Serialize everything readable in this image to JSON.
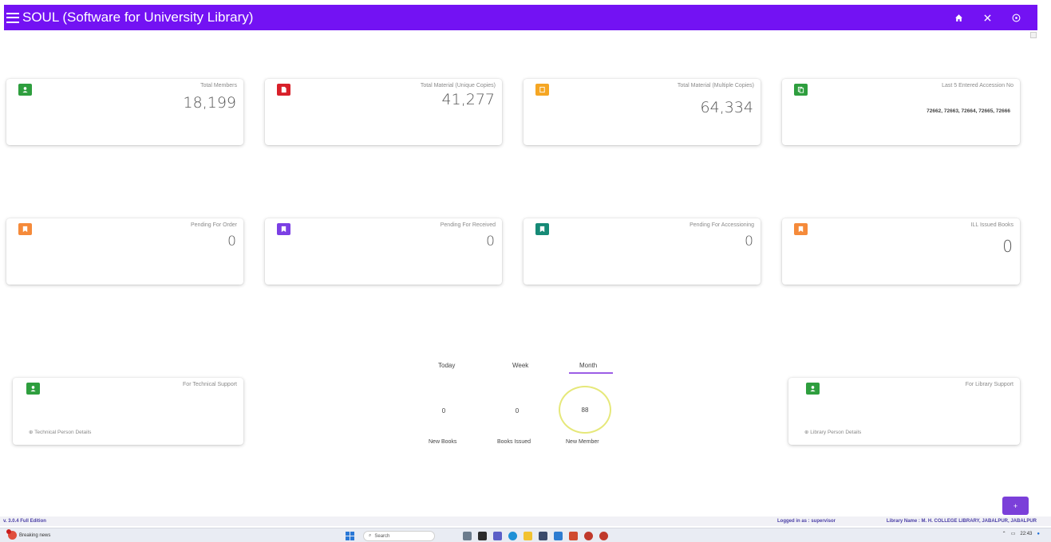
{
  "app": {
    "title": "SOUL (Software for University Library)"
  },
  "topbar": {
    "icons": [
      "menu-icon",
      "home-icon",
      "close-icon",
      "help-icon"
    ]
  },
  "stats_row1": [
    {
      "label": "Total Members",
      "value": "18,199",
      "color": "#2e9e3e",
      "icon": "user-icon"
    },
    {
      "label": "Total Material (Unique Copies)",
      "value": "41,277",
      "color": "#d8202a",
      "icon": "document-icon"
    },
    {
      "label": "Total Material (Multiple Copies)",
      "value": "64,334",
      "color": "#f5a623",
      "icon": "book-icon"
    },
    {
      "label": "Last 5 Entered Accession No",
      "value": "72662, 72663, 72664, 72665, 72666",
      "color": "#2e9e3e",
      "icon": "copy-icon"
    }
  ],
  "stats_row2": [
    {
      "label": "Pending For Order",
      "value": "0",
      "color": "#f58a3a",
      "icon": "book-icon"
    },
    {
      "label": "Pending For Received",
      "value": "0",
      "color": "#7b3fe4",
      "icon": "book-icon"
    },
    {
      "label": "Pending For Accessioning",
      "value": "0",
      "color": "#168a76",
      "icon": "book-icon"
    },
    {
      "label": "ILL Issued Books",
      "value": "0",
      "color": "#f58a3a",
      "icon": "book-icon"
    }
  ],
  "support": {
    "technical": {
      "label": "For Technical Support",
      "link": "Technical Person Details",
      "color": "#2e9e3e"
    },
    "library": {
      "label": "For Library Support",
      "link": "Library Person Details",
      "color": "#2e9e3e"
    }
  },
  "activity": {
    "tabs": [
      "Today",
      "Week",
      "Month"
    ],
    "active_tab": "Month",
    "counters": [
      {
        "value": "0",
        "label": "New Books"
      },
      {
        "value": "0",
        "label": "Books Issued"
      },
      {
        "value": "88",
        "label": "New Member"
      }
    ]
  },
  "fab": {
    "label": "+"
  },
  "footer": {
    "version": "v. 3.0.4   Full Edition",
    "logged_in": "Logged in as : supervisor",
    "library_name": "Library Name : M. H. COLLEGE LIBRARY, JABALPUR, JABALPUR"
  },
  "taskbar": {
    "news": "Breaking news",
    "search_placeholder": "Search",
    "time": "22:43"
  }
}
